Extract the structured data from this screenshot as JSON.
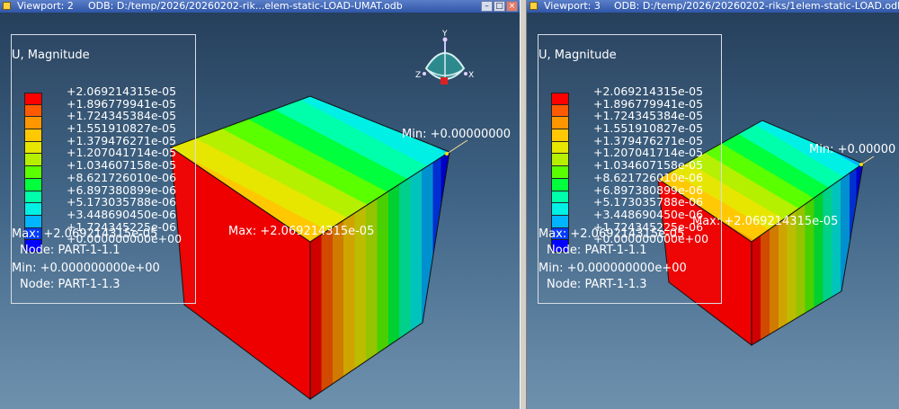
{
  "legend": {
    "title": "U, Magnitude",
    "values": [
      "+2.069214315e-05",
      "+1.896779941e-05",
      "+1.724345384e-05",
      "+1.551910827e-05",
      "+1.379476271e-05",
      "+1.207041714e-05",
      "+1.034607158e-05",
      "+8.621726010e-06",
      "+6.897380899e-06",
      "+5.173035788e-06",
      "+3.448690450e-06",
      "+1.724345225e-06",
      "+0.000000000e+00"
    ],
    "colors": [
      "#ff0000",
      "#ff5a00",
      "#ff9600",
      "#ffc800",
      "#e6e600",
      "#b4f000",
      "#5aff00",
      "#00ff3c",
      "#00ffaa",
      "#00f0e6",
      "#00b4ff",
      "#003cff",
      "#0000ff"
    ],
    "max_label": "Max: +2.069214315e-05",
    "max_node": "Node: PART-1-1.1",
    "min_label": "Min: +0.000000000e+00",
    "min_node": "Node: PART-1-1.3"
  },
  "triad": {
    "y": "Y",
    "x": "X",
    "z": "Z"
  },
  "viewport_left": {
    "title": "Viewport: 2",
    "odb": "ODB: D:/temp/2026/20260202-rik...elem-static-LOAD-UMAT.odb",
    "min_overlay": "Min: +0.00000000",
    "max_overlay": "Max: +2.069214315e-05"
  },
  "viewport_right": {
    "title": "Viewport: 3",
    "odb": "ODB: D:/temp/2026/20260202-riks/1elem-static-LOAD.odb",
    "min_overlay": "Min: +0.00000",
    "max_overlay": "Max: +2.069214315e-05"
  },
  "window_buttons": {
    "minimize": "–",
    "maximize": "□",
    "close": "×"
  }
}
